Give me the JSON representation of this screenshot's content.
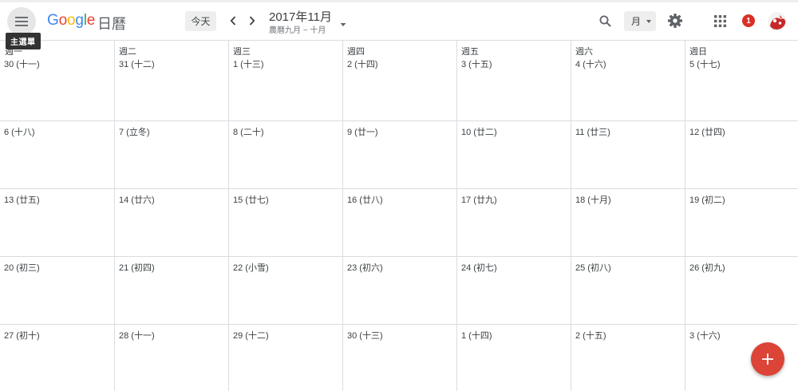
{
  "app": {
    "logo_text": [
      "G",
      "o",
      "o",
      "g",
      "l",
      "e"
    ],
    "name": "日曆",
    "menu_tooltip": "主選單"
  },
  "toolbar": {
    "today_label": "今天",
    "date_title": "2017年11月",
    "date_subtitle": "農曆九月 ~ 十月",
    "view_label": "月",
    "notification_count": "1"
  },
  "calendar": {
    "weekdays": [
      "週一",
      "週二",
      "週三",
      "週四",
      "週五",
      "週六",
      "週日"
    ],
    "weeks": [
      [
        "30 (十一)",
        "31 (十二)",
        "1 (十三)",
        "2 (十四)",
        "3 (十五)",
        "4 (十六)",
        "5 (十七)"
      ],
      [
        "6 (十八)",
        "7 (立冬)",
        "8 (二十)",
        "9 (廿一)",
        "10 (廿二)",
        "11 (廿三)",
        "12 (廿四)"
      ],
      [
        "13 (廿五)",
        "14 (廿六)",
        "15 (廿七)",
        "16 (廿八)",
        "17 (廿九)",
        "18 (十月)",
        "19 (初二)"
      ],
      [
        "20 (初三)",
        "21 (初四)",
        "22 (小雪)",
        "23 (初六)",
        "24 (初七)",
        "25 (初八)",
        "26 (初九)"
      ],
      [
        "27 (初十)",
        "28 (十一)",
        "29 (十二)",
        "30 (十三)",
        "1 (十四)",
        "2 (十五)",
        "3 (十六)"
      ]
    ]
  },
  "icons": {
    "menu": "hamburger-menu-icon",
    "prev": "chevron-left-icon",
    "next": "chevron-right-icon",
    "search": "search-icon",
    "settings": "gear-icon",
    "apps": "apps-grid-icon",
    "add": "plus-icon"
  },
  "colors": {
    "fab": "#db4437",
    "badge": "#d93025",
    "grid_line": "#dadce0"
  }
}
